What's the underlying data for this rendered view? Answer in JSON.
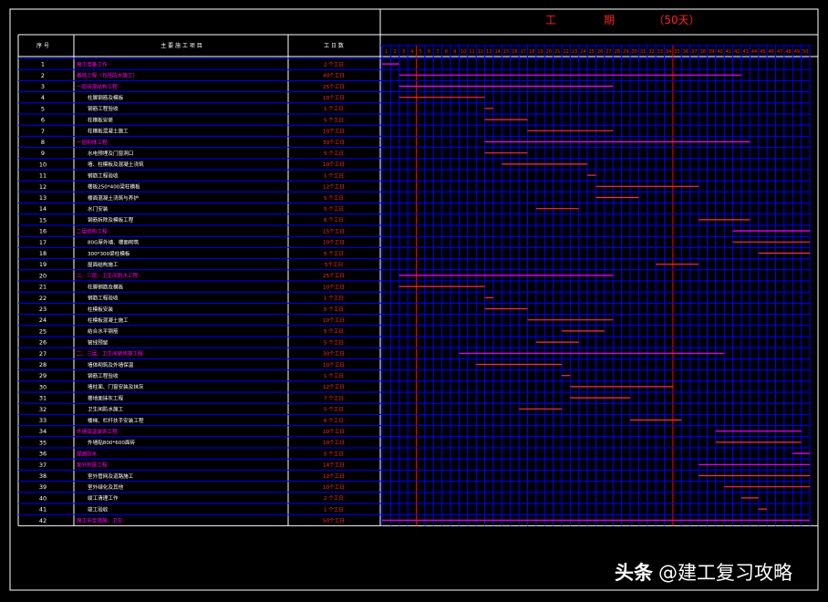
{
  "title": {
    "left": "工",
    "mid": "期",
    "days": "（50天）"
  },
  "header": {
    "seq": "序  号",
    "name": "主 要 施 工 项 目",
    "days": "工 日 数"
  },
  "watermark": {
    "brand": "头条",
    "handle": "@建工复习攻略"
  },
  "colors": {
    "bg": "#000000",
    "grid": "#0000ff",
    "line": "#ffffff",
    "redline": "#ff0000",
    "magenta": "#ff00ff",
    "text": "#ffffff",
    "daytext": "#ff2020",
    "bar": "#ff3030"
  },
  "day_count": 50,
  "tasks": [
    {
      "n": "1",
      "name": "施工准备工作",
      "days": "2  个工日",
      "hl": true,
      "start": 1,
      "end": 2
    },
    {
      "n": "2",
      "name": "基础工程（包括防水施工）",
      "days": "40个工日",
      "hl": true,
      "start": 3,
      "end": 42
    },
    {
      "n": "3",
      "name": "一层砖混结构工程",
      "days": "25个工日",
      "hl": true,
      "start": 3,
      "end": 27
    },
    {
      "n": "4",
      "name": "柱脚钢筋及模板",
      "days": "10个工日",
      "hl": false,
      "start": 3,
      "end": 12
    },
    {
      "n": "5",
      "name": "钢筋工程验收",
      "days": "1  个工日",
      "hl": false,
      "start": 13,
      "end": 13
    },
    {
      "n": "6",
      "name": "柱模板安装",
      "days": "5  个工日",
      "hl": false,
      "start": 13,
      "end": 17
    },
    {
      "n": "7",
      "name": "柱模板混凝土施工",
      "days": "10个工日",
      "hl": false,
      "start": 18,
      "end": 27
    },
    {
      "n": "8",
      "name": "一层砌体工程",
      "days": "30个工日",
      "hl": true,
      "start": 13,
      "end": 43
    },
    {
      "n": "9",
      "name": "水电预埋及门窗洞口",
      "days": "5  个工日",
      "hl": false,
      "start": 13,
      "end": 17
    },
    {
      "n": "10",
      "name": "墙、柱模板及混凝土浇筑",
      "days": "10个工日",
      "hl": false,
      "start": 15,
      "end": 24
    },
    {
      "n": "11",
      "name": "钢筋工程验收",
      "days": "1  个工日",
      "hl": false,
      "start": 25,
      "end": 25
    },
    {
      "n": "12",
      "name": "楼板250*400梁柱模板",
      "days": "12个工日",
      "hl": false,
      "start": 26,
      "end": 37
    },
    {
      "n": "13",
      "name": "楼面混凝土浇筑与养护",
      "days": "5  个工日",
      "hl": false,
      "start": 26,
      "end": 30
    },
    {
      "n": "14",
      "name": "水门安装",
      "days": "5  个工日",
      "hl": false,
      "start": 19,
      "end": 23
    },
    {
      "n": "15",
      "name": "钢筋拆除及模板工程",
      "days": "6  个工日",
      "hl": false,
      "start": 38,
      "end": 43
    },
    {
      "n": "16",
      "name": "二层结构工程",
      "days": "15个工日",
      "hl": true,
      "start": 42,
      "end": 50
    },
    {
      "n": "17",
      "name": "80G厚外墙、楼面砌筑",
      "days": "10个工日",
      "hl": false,
      "start": 42,
      "end": 50
    },
    {
      "n": "18",
      "name": "300*300梁柱模板",
      "days": "5  个工日",
      "hl": false,
      "start": 45,
      "end": 50
    },
    {
      "n": "19",
      "name": "屋面结构施工",
      "days": "5个工日",
      "hl": false,
      "start": 33,
      "end": 37
    },
    {
      "n": "20",
      "name": "二、三层、卫生间防水工程",
      "days": "25个工日",
      "hl": true,
      "start": 3,
      "end": 27
    },
    {
      "n": "21",
      "name": "柱脚钢筋及模板",
      "days": "10个工日",
      "hl": false,
      "start": 3,
      "end": 12
    },
    {
      "n": "22",
      "name": "钢筋工程验收",
      "days": "1  个工日",
      "hl": false,
      "start": 13,
      "end": 13
    },
    {
      "n": "23",
      "name": "柱模板安装",
      "days": "5  个工日",
      "hl": false,
      "start": 13,
      "end": 17
    },
    {
      "n": "24",
      "name": "柱模板混凝土施工",
      "days": "10个工日",
      "hl": false,
      "start": 18,
      "end": 27
    },
    {
      "n": "25",
      "name": "结合水平钢筋",
      "days": "5  个工日",
      "hl": false,
      "start": 22,
      "end": 26
    },
    {
      "n": "26",
      "name": "管线预留",
      "days": "5  个工日",
      "hl": false,
      "start": 19,
      "end": 23
    },
    {
      "n": "27",
      "name": "二、三层、卫生间装修等工程",
      "days": "30个工日",
      "hl": true,
      "start": 10,
      "end": 40
    },
    {
      "n": "28",
      "name": "墙体砌筑及外墙保温",
      "days": "10个工日",
      "hl": false,
      "start": 12,
      "end": 21
    },
    {
      "n": "29",
      "name": "钢筋工程验收",
      "days": "1  个工日",
      "hl": false,
      "start": 22,
      "end": 22
    },
    {
      "n": "30",
      "name": "墙柱面、门窗安装及抹灰",
      "days": "12个工日",
      "hl": false,
      "start": 23,
      "end": 34
    },
    {
      "n": "31",
      "name": "楼地面抹灰工程",
      "days": "7  个工日",
      "hl": false,
      "start": 23,
      "end": 29
    },
    {
      "n": "32",
      "name": "卫生间防水施工",
      "days": "5  个工日",
      "hl": false,
      "start": 17,
      "end": 21
    },
    {
      "n": "33",
      "name": "楼梯、栏杆扶手安装工程",
      "days": "6  个工日",
      "hl": false,
      "start": 30,
      "end": 35
    },
    {
      "n": "34",
      "name": "外墙保温装饰工程",
      "days": "10个工日",
      "hl": true,
      "start": 40,
      "end": 49
    },
    {
      "n": "35",
      "name": "外墙贴800*600面砖",
      "days": "10个工日",
      "hl": false,
      "start": 40,
      "end": 49
    },
    {
      "n": "36",
      "name": "屋面防水",
      "days": "5  个工日",
      "hl": true,
      "start": 49,
      "end": 50
    },
    {
      "n": "37",
      "name": "室外附属工程",
      "days": "14个工日",
      "hl": true,
      "start": 38,
      "end": 50
    },
    {
      "n": "38",
      "name": "室外管网及道路施工",
      "days": "12个工日",
      "hl": false,
      "start": 38,
      "end": 50
    },
    {
      "n": "39",
      "name": "室外绿化及其他",
      "days": "10个工日",
      "hl": false,
      "start": 41,
      "end": 50
    },
    {
      "n": "40",
      "name": "竣工清理工作",
      "days": "2  个工日",
      "hl": false,
      "start": 43,
      "end": 44
    },
    {
      "n": "41",
      "name": "竣工验收",
      "days": "1  个工日",
      "hl": false,
      "start": 45,
      "end": 45
    },
    {
      "n": "42",
      "name": "施工安全措施、卫生",
      "days": "50个工日",
      "hl": true,
      "start": 1,
      "end": 50
    }
  ]
}
